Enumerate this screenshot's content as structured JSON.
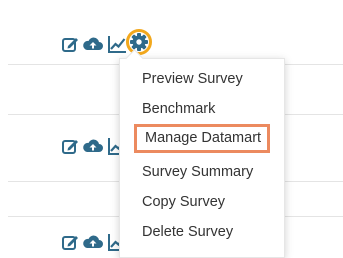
{
  "colors": {
    "icon": "#2f6a8a",
    "gear_highlight": "#f2a81d",
    "menu_highlight": "#ec8a5f",
    "divider": "#e4e4e4"
  },
  "icons": [
    "edit-icon",
    "cloud-upload-icon",
    "chart-icon",
    "gear-icon"
  ],
  "menu": {
    "items": [
      {
        "label": "Preview Survey"
      },
      {
        "label": "Benchmark"
      },
      {
        "label": "Manage Datamart",
        "highlighted": true
      },
      {
        "label": "Survey Summary"
      },
      {
        "label": "Copy Survey"
      },
      {
        "label": "Delete Survey"
      }
    ]
  }
}
